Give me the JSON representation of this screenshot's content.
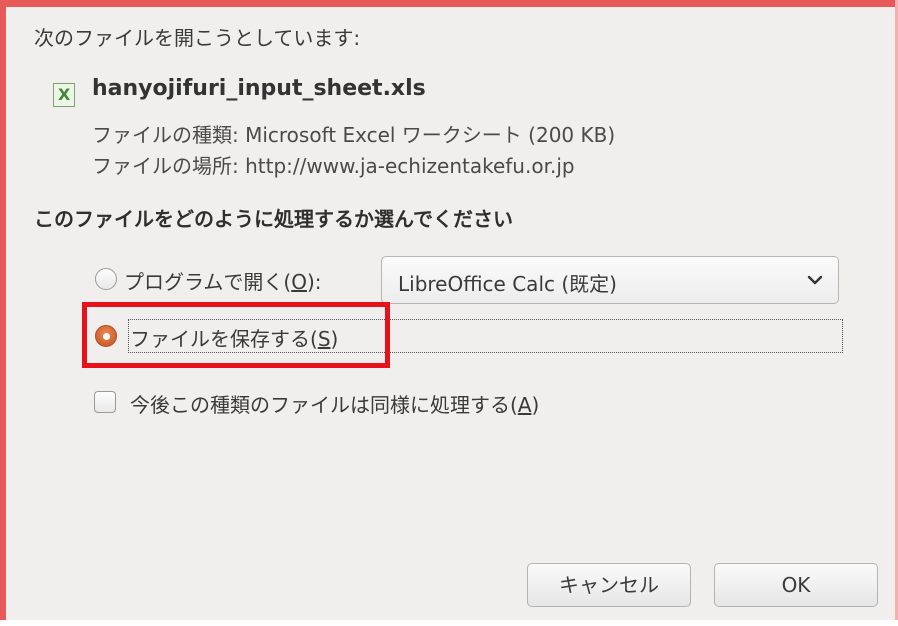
{
  "dialog": {
    "prompt": "次のファイルを開こうとしています:",
    "file": {
      "icon": "spreadsheet-file-icon",
      "icon_glyph": "X",
      "name": "hanyojifuri_input_sheet.xls",
      "type_line": "ファイルの種類: Microsoft Excel ワークシート (200 KB)",
      "location_line": "ファイルの場所: http://www.ja-echizentakefu.or.jp"
    },
    "question": "このファイルをどのように処理するか選んでください",
    "options": {
      "open_with": {
        "label": "プログラムで開く(",
        "mnemonic": "O",
        "suffix": "):",
        "selected": false,
        "app": "LibreOffice Calc (既定)"
      },
      "save_file": {
        "label": "ファイルを保存する(",
        "mnemonic": "S",
        "suffix": ")",
        "selected": true
      },
      "remember": {
        "label": "今後この種類のファイルは同様に処理する(",
        "mnemonic": "A",
        "suffix": ")",
        "checked": false
      }
    },
    "buttons": {
      "cancel": "キャンセル",
      "ok": "OK"
    }
  },
  "colors": {
    "window_frame": "#e85a5a",
    "highlight_box": "#e8111a",
    "radio_selected": "#d0602e"
  }
}
